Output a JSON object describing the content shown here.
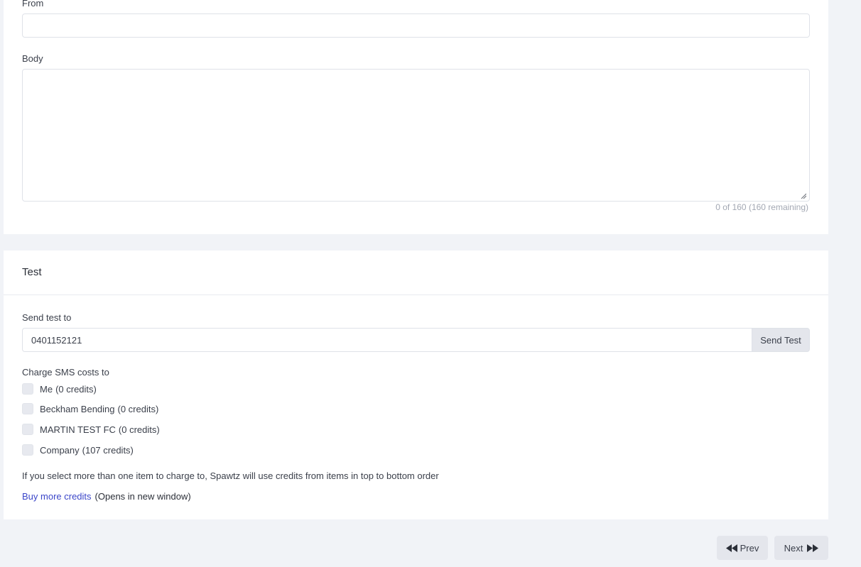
{
  "message": {
    "from_label": "From",
    "from_value": "",
    "body_label": "Body",
    "body_value": "",
    "counter": "0 of 160",
    "counter_remaining": "(160 remaining)"
  },
  "test": {
    "title": "Test",
    "send_to_label": "Send test to",
    "phone_value": "0401152121",
    "send_button": "Send Test",
    "charge_label": "Charge SMS costs to",
    "options": [
      {
        "name": "Me",
        "credits": "(0 credits)"
      },
      {
        "name": "Beckham Bending",
        "credits": "(0 credits)"
      },
      {
        "name": "MARTIN TEST FC",
        "credits": "(0 credits)"
      },
      {
        "name": "Company",
        "credits": "(107 credits)"
      }
    ],
    "note": "If you select more than one item to charge to, Spawtz will use credits from items in top to bottom order",
    "buy_link": "Buy more credits",
    "buy_note": "(Opens in new window)"
  },
  "pager": {
    "prev": "Prev",
    "next": "Next"
  },
  "icons": {
    "prev": "double-chevron-left-icon",
    "next": "double-chevron-right-icon"
  },
  "colors": {
    "link": "#3b46c9",
    "button_bg": "#e4e6ec",
    "page_bg": "#f1f3f7"
  }
}
